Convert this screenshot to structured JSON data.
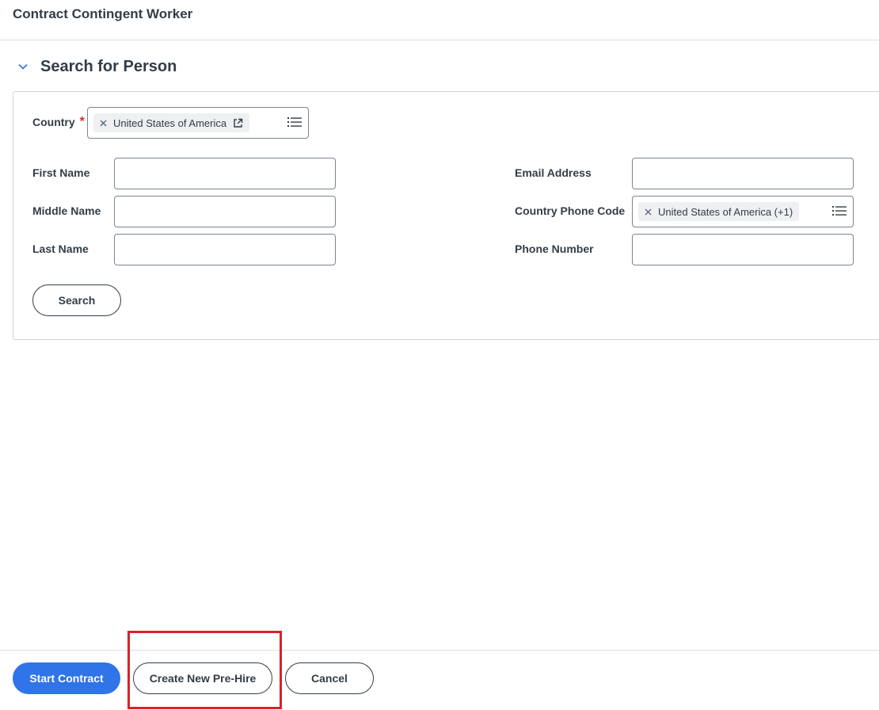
{
  "page": {
    "title": "Contract Contingent Worker"
  },
  "section": {
    "title": "Search for Person",
    "expand_icon": "chevron-down-icon"
  },
  "form": {
    "country": {
      "label": "Country",
      "required_marker": "*",
      "selected_value": "United States of America",
      "remove_icon": "close-icon",
      "open_icon": "external-link-icon",
      "list_icon": "list-icon"
    },
    "first_name": {
      "label": "First Name",
      "value": ""
    },
    "middle_name": {
      "label": "Middle Name",
      "value": ""
    },
    "last_name": {
      "label": "Last Name",
      "value": ""
    },
    "email_address": {
      "label": "Email Address",
      "value": ""
    },
    "country_phone_code": {
      "label": "Country Phone Code",
      "selected_value": "United States of America (+1)",
      "remove_icon": "close-icon",
      "list_icon": "list-icon"
    },
    "phone_number": {
      "label": "Phone Number",
      "value": ""
    },
    "search_button": "Search"
  },
  "footer": {
    "start_contract_button": "Start Contract",
    "create_pre_hire_button": "Create New Pre-Hire",
    "cancel_button": "Cancel"
  },
  "colors": {
    "primary": "#2f74e8",
    "required": "#de2e21",
    "highlight": "#d9222a",
    "text": "#333d47"
  }
}
